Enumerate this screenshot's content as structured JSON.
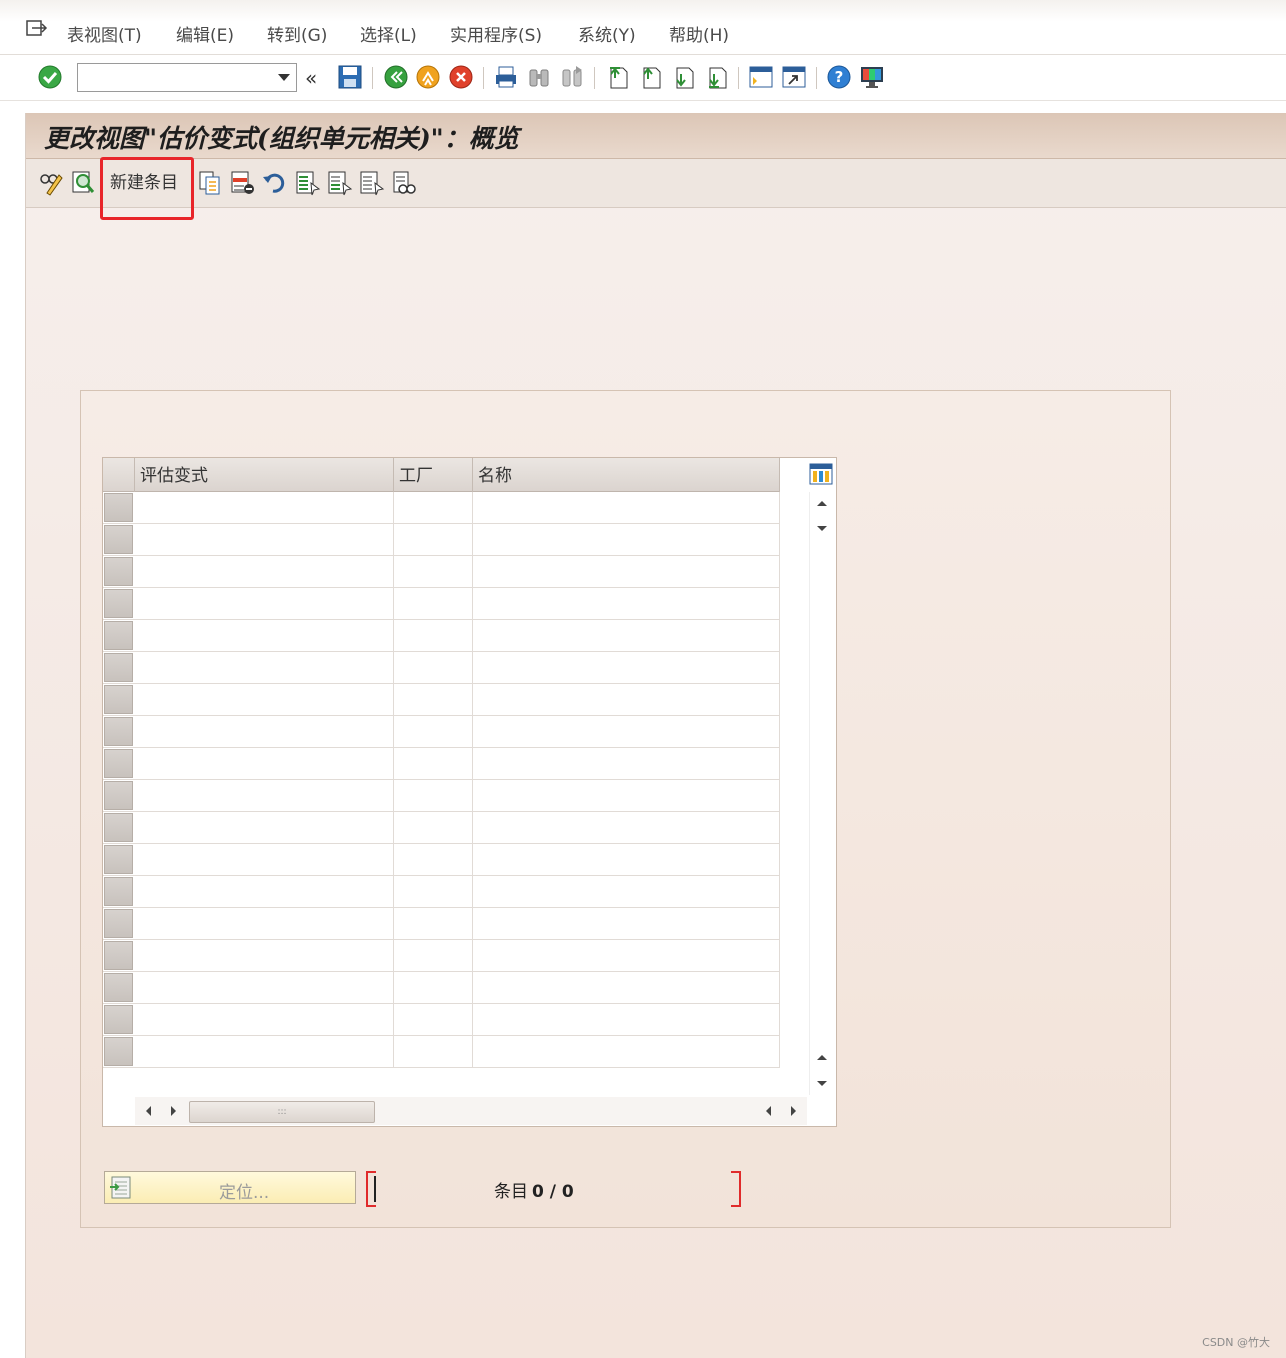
{
  "menubar": {
    "items": [
      {
        "label": "表视图(T)"
      },
      {
        "label": "编辑(E)"
      },
      {
        "label": "转到(G)"
      },
      {
        "label": "选择(L)"
      },
      {
        "label": "实用程序(S)"
      },
      {
        "label": "系统(Y)"
      },
      {
        "label": "帮助(H)"
      }
    ]
  },
  "standard_toolbar": {
    "command_field_value": "",
    "icons": [
      "enter-icon",
      "collapse-icon",
      "save-icon",
      "back-icon",
      "exit-icon",
      "cancel-icon",
      "print-icon",
      "find-icon",
      "find-next-icon",
      "first-page-icon",
      "previous-page-icon",
      "next-page-icon",
      "last-page-icon",
      "create-session-icon",
      "shortcut-icon",
      "help-icon",
      "customize-layout-icon"
    ]
  },
  "title": "更改视图\"估价变式(组织单元相关)\"：概览",
  "app_toolbar": {
    "new_entries_label": "新建条目",
    "icons": [
      "display-change-icon",
      "display-details-icon",
      "copy-as-icon",
      "delete-icon",
      "undo-change-icon",
      "select-all-icon",
      "select-block-icon",
      "deselect-all-icon",
      "print-field-list-icon"
    ]
  },
  "table": {
    "columns": [
      {
        "label": "评估变式"
      },
      {
        "label": "工厂"
      },
      {
        "label": "名称"
      }
    ],
    "rows": [
      [
        "",
        "",
        ""
      ],
      [
        "",
        "",
        ""
      ],
      [
        "",
        "",
        ""
      ],
      [
        "",
        "",
        ""
      ],
      [
        "",
        "",
        ""
      ],
      [
        "",
        "",
        ""
      ],
      [
        "",
        "",
        ""
      ],
      [
        "",
        "",
        ""
      ],
      [
        "",
        "",
        ""
      ],
      [
        "",
        "",
        ""
      ],
      [
        "",
        "",
        ""
      ],
      [
        "",
        "",
        ""
      ],
      [
        "",
        "",
        ""
      ],
      [
        "",
        "",
        ""
      ],
      [
        "",
        "",
        ""
      ],
      [
        "",
        "",
        ""
      ],
      [
        "",
        "",
        ""
      ],
      [
        "",
        "",
        ""
      ]
    ]
  },
  "position_button": {
    "label": "定位..."
  },
  "entries": {
    "label": "条目",
    "count": "0 / 0"
  },
  "watermark": "CSDN @竹大",
  "colors": {
    "highlight": "#e8252a",
    "title_bg": "#dcc6b6",
    "screen_bg": "#f3e4dc"
  }
}
